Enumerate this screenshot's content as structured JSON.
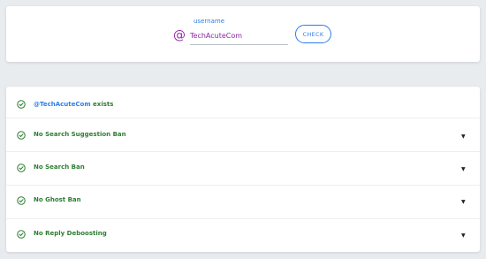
{
  "form": {
    "username_label": "username",
    "at_symbol": "@",
    "username_value": "TechAcuteCom",
    "check_label": "CHECK"
  },
  "results": {
    "exists": {
      "handle": "@TechAcuteCom",
      "suffix": " exists"
    },
    "rows": [
      {
        "label": "No Search Suggestion Ban",
        "expand": "▼"
      },
      {
        "label": "No Search Ban",
        "expand": "▼"
      },
      {
        "label": "No Ghost Ban",
        "expand": "▼"
      },
      {
        "label": "No Reply Deboosting",
        "expand": "▼"
      }
    ]
  },
  "colors": {
    "accent": "#2b7de9",
    "success": "#2e7d32",
    "at_symbol": "#9c27b0"
  }
}
